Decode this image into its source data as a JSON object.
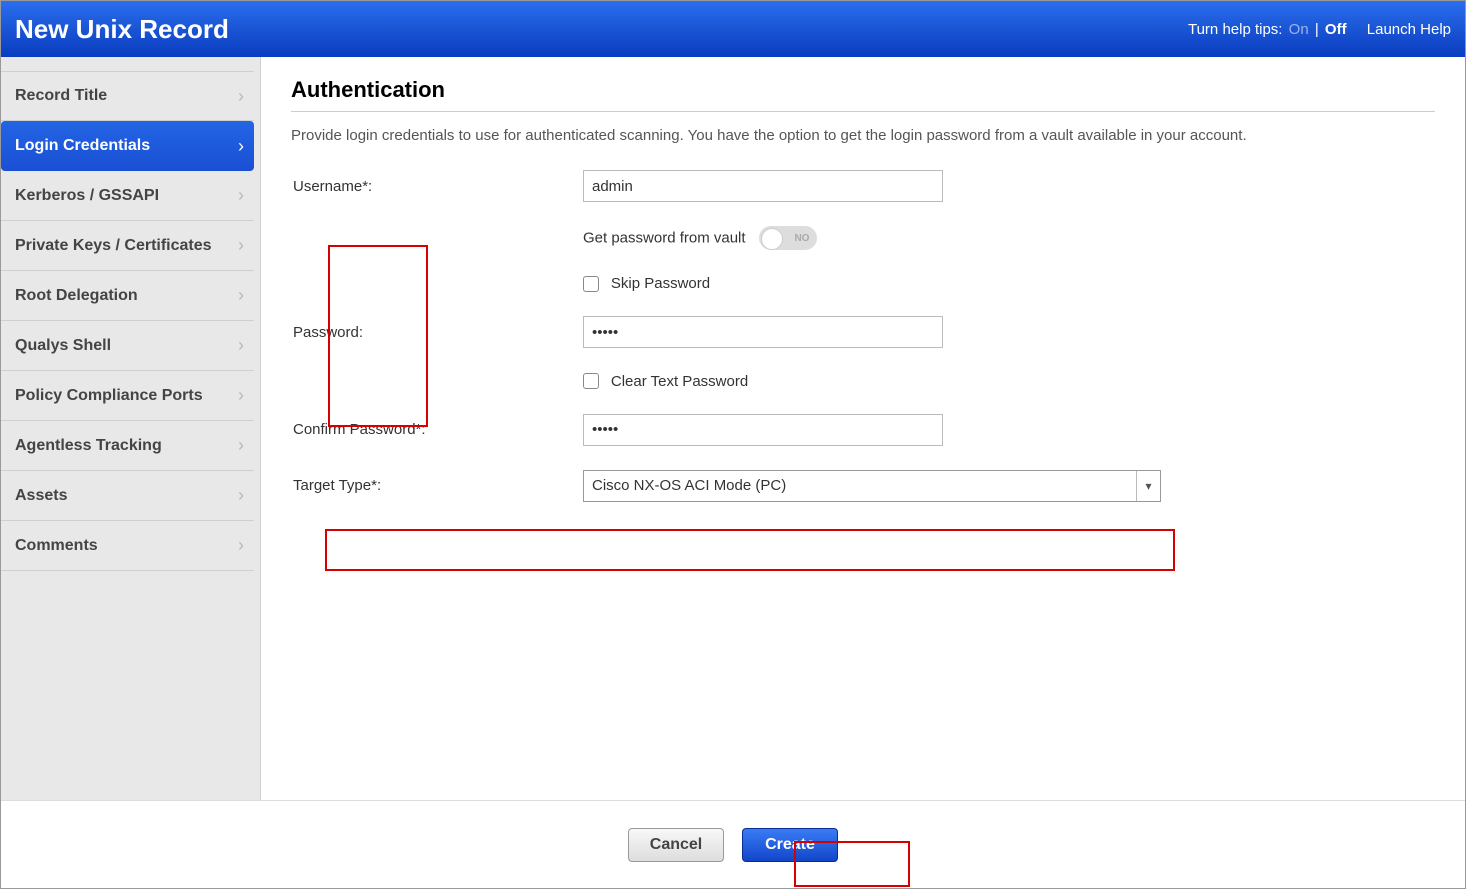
{
  "header": {
    "title": "New Unix Record",
    "help_label": "Turn help tips:",
    "on_label": "On",
    "off_label": "Off",
    "launch_label": "Launch Help"
  },
  "sidebar": {
    "items": [
      {
        "label": "Record Title",
        "active": false
      },
      {
        "label": "Login Credentials",
        "active": true
      },
      {
        "label": "Kerberos / GSSAPI",
        "active": false
      },
      {
        "label": "Private Keys / Certificates",
        "active": false
      },
      {
        "label": "Root Delegation",
        "active": false
      },
      {
        "label": "Qualys Shell",
        "active": false
      },
      {
        "label": "Policy Compliance Ports",
        "active": false
      },
      {
        "label": "Agentless Tracking",
        "active": false
      },
      {
        "label": "Assets",
        "active": false
      },
      {
        "label": "Comments",
        "active": false
      }
    ]
  },
  "page": {
    "heading": "Authentication",
    "description": "Provide login credentials to use for authenticated scanning. You have the option to get the login password from a vault available in your account."
  },
  "form": {
    "username_label": "Username*:",
    "username_value": "admin",
    "vault_label": "Get password from vault",
    "vault_toggle_text": "NO",
    "skip_password_label": "Skip Password",
    "password_label": "Password:",
    "password_value": "•••••",
    "cleartext_label": "Clear Text Password",
    "confirm_label": "Confirm Password*:",
    "confirm_value": "•••••",
    "target_label": "Target Type*:",
    "target_value": "Cisco NX-OS ACI Mode (PC)"
  },
  "footer": {
    "cancel": "Cancel",
    "create": "Create"
  }
}
